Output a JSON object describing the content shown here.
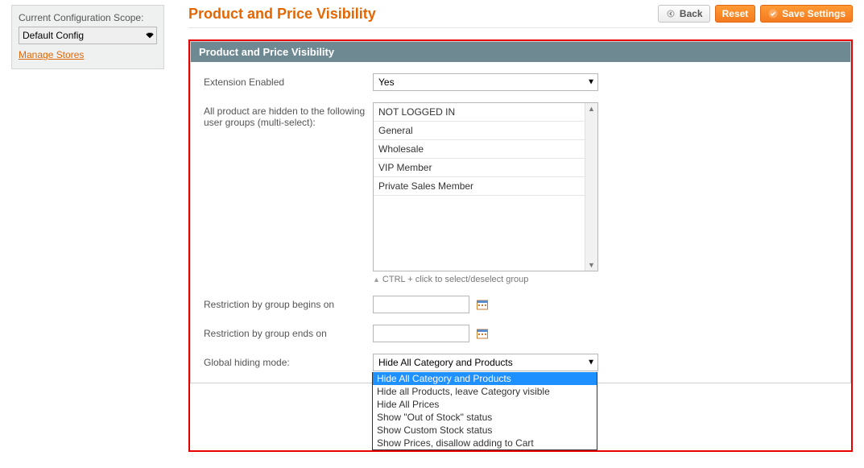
{
  "sidebar": {
    "scope_label": "Current Configuration Scope:",
    "scope_value": "Default Config",
    "manage_link": "Manage Stores"
  },
  "header": {
    "title": "Product and Price Visibility",
    "back": "Back",
    "reset": "Reset",
    "save": "Save Settings"
  },
  "section": {
    "title": "Product and Price Visibility",
    "fields": {
      "enabled_label": "Extension Enabled",
      "enabled_value": "Yes",
      "groups_label": "All product are hidden to the following user groups (multi-select):",
      "groups": [
        "NOT LOGGED IN",
        "General",
        "Wholesale",
        "VIP Member",
        "Private Sales Member"
      ],
      "groups_hint": "CTRL + click to select/deselect group",
      "begins_label": "Restriction by group begins on",
      "begins_value": "",
      "ends_label": "Restriction by group ends on",
      "ends_value": "",
      "mode_label": "Global hiding mode:",
      "mode_value": "Hide All Category and Products",
      "mode_options": [
        "Hide All Category and Products",
        "Hide all Products, leave Category visible",
        "Hide All Prices",
        "Show \"Out of Stock\" status",
        "Show Custom Stock status",
        "Show Prices, disallow adding to Cart"
      ]
    }
  }
}
